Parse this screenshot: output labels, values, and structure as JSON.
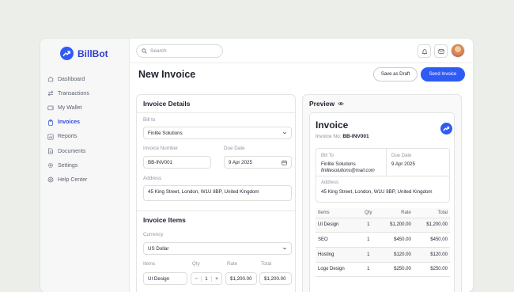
{
  "app": {
    "name": "BillBot"
  },
  "sidebar": {
    "items": [
      {
        "label": "Dashboard",
        "icon": "home-icon",
        "active": false
      },
      {
        "label": "Transactions",
        "icon": "arrows-icon",
        "active": false
      },
      {
        "label": "My Wallet",
        "icon": "wallet-icon",
        "active": false
      },
      {
        "label": "Invoices",
        "icon": "clipboard-icon",
        "active": true
      },
      {
        "label": "Reports",
        "icon": "chart-icon",
        "active": false
      },
      {
        "label": "Documents",
        "icon": "document-icon",
        "active": false
      },
      {
        "label": "Settings",
        "icon": "gear-icon",
        "active": false
      },
      {
        "label": "Help Center",
        "icon": "help-icon",
        "active": false
      }
    ]
  },
  "topbar": {
    "search_placeholder": "Search"
  },
  "header": {
    "title": "New Invoice",
    "draft_label": "Save as Draft",
    "send_label": "Send Invoice"
  },
  "details": {
    "title": "Invoice Details",
    "bill_to_label": "Bill to",
    "bill_to_value": "Finlite Solutions",
    "number_label": "Invoice Number",
    "number_value": "BB-INV001",
    "due_label": "Due Date",
    "due_value": "9 Apr 2025",
    "address_label": "Address",
    "address_value": "45 King Street, London, W1U 8BP, United Kingdom"
  },
  "items_section": {
    "title": "Invoice Items",
    "currency_label": "Currency",
    "currency_value": "US Dollar",
    "col_items": "Items",
    "col_qty": "Qty",
    "col_rate": "Rate",
    "col_total": "Total",
    "first_row": {
      "item": "UI Design",
      "minus": "−",
      "qty": "1",
      "plus": "+",
      "rate": "$1,200.00",
      "total": "$1,200.00"
    }
  },
  "preview": {
    "title": "Preview",
    "heading": "Invoice",
    "no_label": "Invoice No:",
    "no_value": "BB-INV001",
    "bill_to_label": "Bill To",
    "bill_to_name": "Finlite Solutions",
    "bill_to_email": "finlitesolutions@mail.com",
    "due_label": "Due Date",
    "due_value": "9 Apr 2025",
    "address_label": "Address",
    "address_value": "45 King Street, London, W1U 8BP, United Kingdom",
    "table": {
      "headers": [
        "Items",
        "Qty",
        "Rate",
        "Total"
      ],
      "rows": [
        [
          "UI Design",
          "1",
          "$1,200.00",
          "$1,200.00"
        ],
        [
          "SEO",
          "1",
          "$450.00",
          "$450.00"
        ],
        [
          "Hosting",
          "1",
          "$120.00",
          "$120.00"
        ],
        [
          "Logo Design",
          "1",
          "$250.00",
          "$250.00"
        ]
      ]
    }
  },
  "colors": {
    "accent": "#2f5bf5",
    "background": "#ecefe9"
  }
}
